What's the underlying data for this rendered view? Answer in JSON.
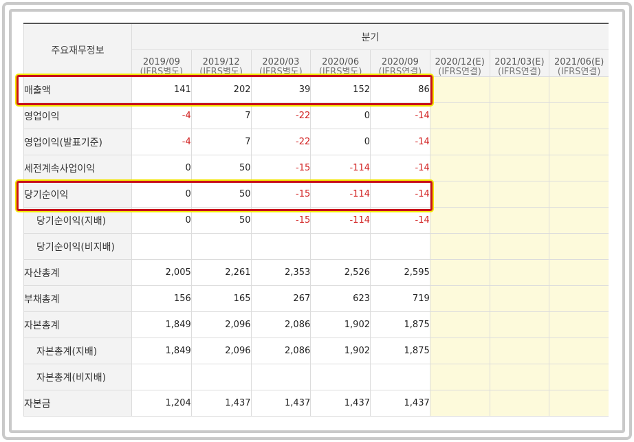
{
  "table": {
    "label_header": "주요재무정보",
    "group_header": "분기",
    "periods": [
      {
        "date": "2019/09",
        "basis": "(IFRS별도)"
      },
      {
        "date": "2019/12",
        "basis": "(IFRS별도)"
      },
      {
        "date": "2020/03",
        "basis": "(IFRS별도)"
      },
      {
        "date": "2020/06",
        "basis": "(IFRS별도)"
      },
      {
        "date": "2020/09",
        "basis": "(IFRS연결)"
      },
      {
        "date": "2020/12(E)",
        "basis": "(IFRS연결)"
      },
      {
        "date": "2021/03(E)",
        "basis": "(IFRS연결)"
      },
      {
        "date": "2021/06(E)",
        "basis": "(IFRS연결)"
      }
    ],
    "rows": [
      {
        "label": "매출액",
        "values": [
          "141",
          "202",
          "39",
          "152",
          "86",
          "",
          "",
          ""
        ]
      },
      {
        "label": "영업이익",
        "values": [
          "-4",
          "7",
          "-22",
          "0",
          "-14",
          "",
          "",
          ""
        ]
      },
      {
        "label": "영업이익(발표기준)",
        "values": [
          "-4",
          "7",
          "-22",
          "0",
          "-14",
          "",
          "",
          ""
        ]
      },
      {
        "label": "세전계속사업이익",
        "values": [
          "0",
          "50",
          "-15",
          "-114",
          "-14",
          "",
          "",
          ""
        ]
      },
      {
        "label": "당기순이익",
        "values": [
          "0",
          "50",
          "-15",
          "-114",
          "-14",
          "",
          "",
          ""
        ]
      },
      {
        "label": "당기순이익(지배)",
        "values": [
          "0",
          "50",
          "-15",
          "-114",
          "-14",
          "",
          "",
          ""
        ]
      },
      {
        "label": "당기순이익(비지배)",
        "values": [
          "",
          "",
          "",
          "",
          "",
          "",
          "",
          ""
        ]
      },
      {
        "label": "자산총계",
        "values": [
          "2,005",
          "2,261",
          "2,353",
          "2,526",
          "2,595",
          "",
          "",
          ""
        ]
      },
      {
        "label": "부채총계",
        "values": [
          "156",
          "165",
          "267",
          "623",
          "719",
          "",
          "",
          ""
        ]
      },
      {
        "label": "자본총계",
        "values": [
          "1,849",
          "2,096",
          "2,086",
          "1,902",
          "1,875",
          "",
          "",
          ""
        ]
      },
      {
        "label": "자본총계(지배)",
        "values": [
          "1,849",
          "2,096",
          "2,086",
          "1,902",
          "1,875",
          "",
          "",
          ""
        ]
      },
      {
        "label": "자본총계(비지배)",
        "values": [
          "",
          "",
          "",
          "",
          "",
          "",
          "",
          ""
        ]
      },
      {
        "label": "자본금",
        "values": [
          "1,204",
          "1,437",
          "1,437",
          "1,437",
          "1,437",
          "",
          "",
          ""
        ]
      }
    ]
  },
  "colors": {
    "negative_value": "#d11f1f",
    "forecast_cell_bg": "#fdfadb",
    "highlight_border": "#c8101a",
    "highlight_glow": "#f3e600"
  }
}
